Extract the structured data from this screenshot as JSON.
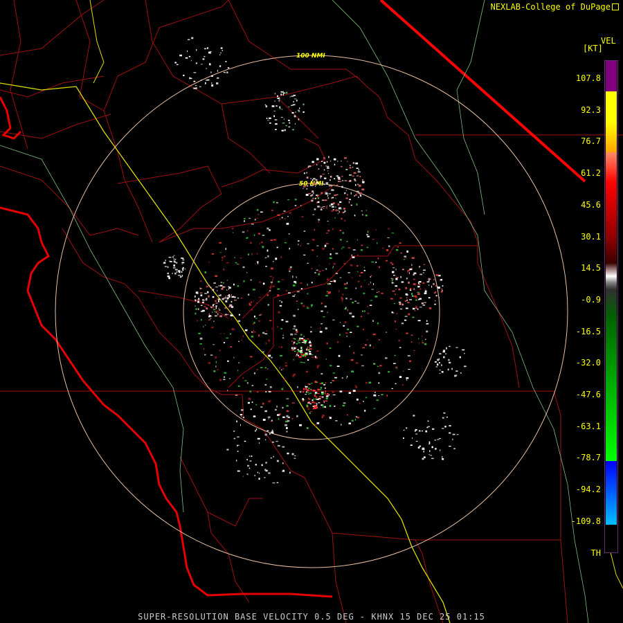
{
  "header": {
    "credit": "NEXLAB-College of DuPage"
  },
  "legend": {
    "title": "VEL",
    "unit": "[KT]",
    "ticks": [
      "107.8",
      "92.3",
      "76.7",
      "61.2",
      "45.6",
      "30.1",
      "14.5",
      "-0.9",
      "-16.5",
      "-32.0",
      "-47.6",
      "-63.1",
      "-78.7",
      "-94.2",
      "-109.8",
      "TH"
    ],
    "colors": [
      "#800080",
      "#ffff00",
      "#ffa500",
      "#ff0000",
      "#8b0000",
      "#ffffff",
      "#808080",
      "#006400",
      "#00ff00",
      "#0000ff",
      "#00bfff"
    ]
  },
  "map": {
    "range_rings": [
      {
        "label": "100 NMI"
      },
      {
        "label": "50 NMI"
      }
    ]
  },
  "footer": {
    "caption": "SUPER-RESOLUTION BASE VELOCITY 0.5 DEG - KHNX 15 DEC 25 01:15"
  }
}
